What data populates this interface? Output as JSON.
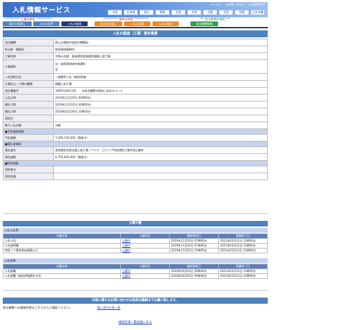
{
  "header": {
    "title": "入札情報サービス",
    "top_links": [
      "★ヘルプ",
      "★お問い合わせ",
      "★全国版TOP"
    ],
    "regions": [
      "全国",
      "北海道",
      "東北",
      "関東",
      "北陸",
      "中部",
      "近畿",
      "中国",
      "四国",
      "九州沖縄"
    ]
  },
  "sections": {
    "construction": "工事の検索",
    "consulting": "業務の検索",
    "org": "発注機関の検索",
    "stars_long": "************",
    "stars_mid": "***********",
    "stars_short": "***"
  },
  "tabs": [
    {
      "label": "発注の見通し",
      "color": "blue"
    },
    {
      "label": "入札公告等",
      "color": "blue"
    },
    {
      "label": "入札の経過",
      "color": "active"
    },
    {
      "label": "発注の見通し",
      "color": "orange"
    },
    {
      "label": "入札公告等",
      "color": "orange"
    },
    {
      "label": "入札の経過",
      "color": "orange"
    },
    {
      "label": "発注機関情報",
      "color": "green"
    }
  ],
  "main_title": "入札の経過（工事）案件概要",
  "details": {
    "rows": [
      {
        "label": "発注機関",
        "value": "国土交通省中部地方整備局"
      },
      {
        "label": "担当部・事務所",
        "value": "岐阜国道事務所"
      },
      {
        "label": "工事名称",
        "value": "令和元年度　東海環状東海環状勝勝上部工事"
      },
      {
        "label": "工事場所",
        "value": "自　岐阜県海津市南濃町\n至"
      },
      {
        "label": "入札契約方式",
        "value": "一般競争入札（総合評価）"
      },
      {
        "label": "工事区分／工事の種類",
        "value": "鋼橋上部工事"
      },
      {
        "label": "設計書番号",
        "value": "1985S1401102　　★発注機関が固有に定めるコード"
      },
      {
        "label": "公告日時",
        "value": "2019年11月20日 00時00分"
      },
      {
        "label": "開札日時",
        "value": "2019年12月02日 00時00分"
      },
      {
        "label": "開札日時",
        "value": "2020年02月26日 10時24分"
      },
      {
        "label": "契約日",
        "value": ""
      },
      {
        "label": "電子入札対象",
        "value": "対象"
      }
    ],
    "estimate_header": "■予定価格情報",
    "estimate": {
      "label": "予定価格",
      "value": "7,266,150,000（税抜き）"
    },
    "winner_header": "■落札者情報",
    "winner": [
      {
        "label": "落札者名",
        "value": "東海環状北東北勝上部工事ＪＴＨＩ　日ファブ特定建設工事共同企業体"
      },
      {
        "label": "落札価格",
        "value": "6,793,000,000（税抜き）"
      }
    ],
    "contract_header": "■契約情報",
    "contract": [
      {
        "label": "契約者名",
        "value": ""
      },
      {
        "label": "契約金額",
        "value": ""
      }
    ]
  },
  "public_docs": {
    "title": "公開文書",
    "group1": {
      "title": "入札公告等",
      "headers": [
        "文書名称",
        "公開状況",
        "最終更新日",
        "掲載終了日"
      ],
      "rows": [
        [
          "入札公告",
          "公開中",
          "2019年11月20日 07時00分",
          "2021年03月31日 23時00分"
        ],
        [
          "入札説明書",
          "公開中",
          "2019年11月20日 07時00分",
          "2021年03月31日 23時00分"
        ],
        [
          "特定ＪＶ競争参加資格公示",
          "公開中",
          "2019年11月22日 10時00分",
          "2021年03月31日 23時00分"
        ]
      ]
    },
    "group2": {
      "title": "入札結果",
      "headers": [
        "文書名称",
        "公開状況",
        "最終更新日",
        "掲載終了日"
      ],
      "rows": [
        [
          "入札調書",
          "公開中",
          "2020年03月03日 09時46分",
          "2021年03月31日 23時00分"
        ],
        [
          "入札調書（総合評価落札方式）",
          "公開中",
          "2020年03月03日 09時46分",
          "2021年03月31日 23時00分"
        ]
      ]
    }
  },
  "contact": {
    "title": "内容に関するお問い合わせは各発注機関までお願い致します。",
    "text": "発注機関への連絡先等はこちらからご確認ください。",
    "link": "問い合わせ先一覧"
  },
  "back_link": "検索結果一覧画面に戻る",
  "colors": {
    "title_bar": "#4f81bd",
    "tab_active": "#1f3b75",
    "tab_orange": "#f08a24",
    "tab_green": "#36a146"
  }
}
